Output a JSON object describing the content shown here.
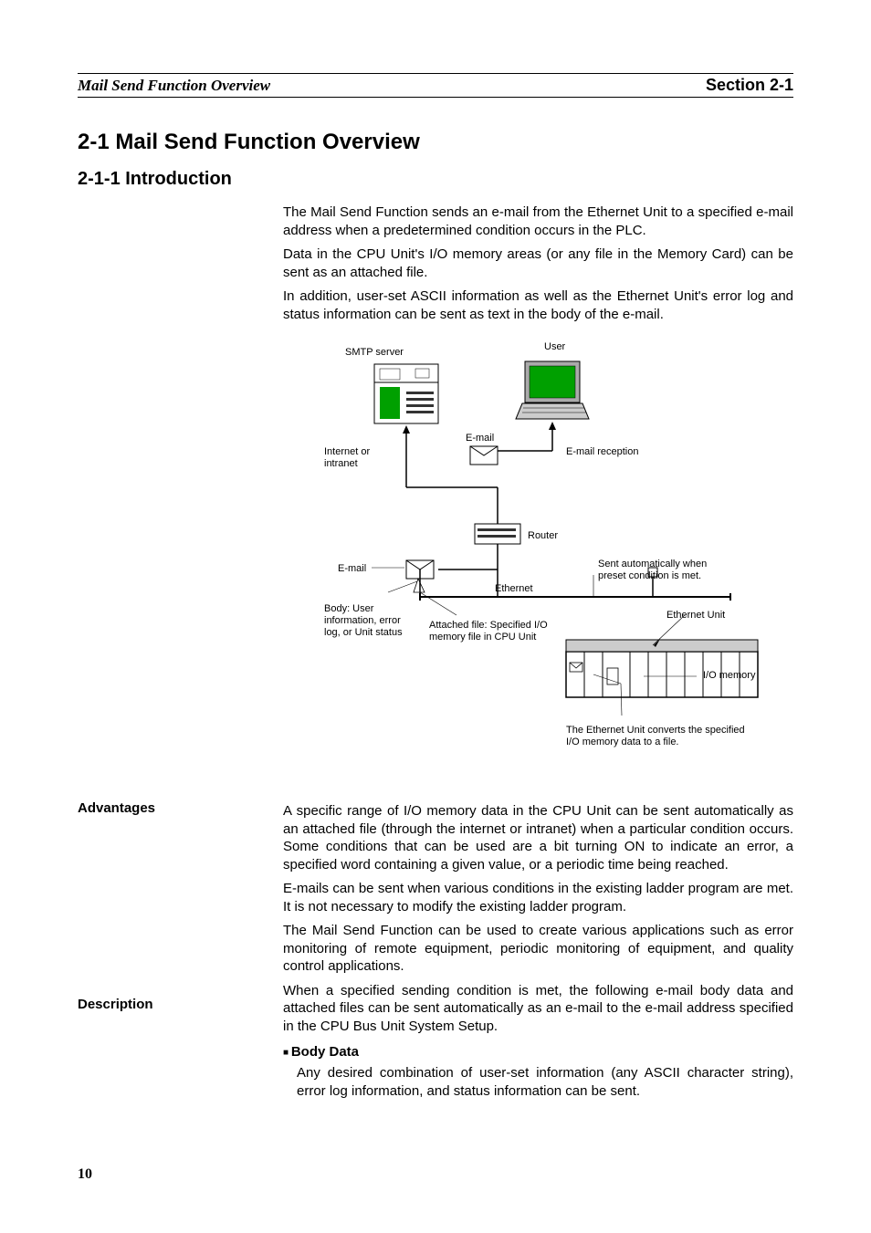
{
  "header": {
    "left": "Mail Send Function Overview",
    "right": "Section 2-1"
  },
  "h1": "2-1    Mail Send Function Overview",
  "h2": "2-1-1    Introduction",
  "intro": {
    "p1": "The Mail Send Function sends an e-mail from the Ethernet Unit to a specified e-mail address when a predetermined condition occurs in the PLC.",
    "p2": "Data in the CPU Unit's I/O memory areas (or any file in the Memory Card) can be sent as an attached file.",
    "p3": "In addition, user-set ASCII information as well as the Ethernet Unit's error log and status information can be sent as text in the body of the e-mail."
  },
  "diagram": {
    "smtp_server": "SMTP server",
    "user": "User",
    "internet": "Internet or intranet",
    "email": "E-mail",
    "email_reception": "E-mail reception",
    "router": "Router",
    "email2": "E-mail",
    "ethernet": "Ethernet",
    "sent_auto": "Sent automatically when preset condition is met.",
    "body_user": "Body: User information, error log, or Unit status",
    "attached_file": "Attached file: Specified I/O memory file in CPU Unit",
    "ethernet_unit": "Ethernet Unit",
    "io_memory": "I/O memory",
    "converts": "The Ethernet Unit converts the specified I/O memory data to a file."
  },
  "advantages": {
    "label": "Advantages",
    "p1": "A specific range of I/O memory data in the CPU Unit can be sent automatically as an attached file (through the internet or intranet) when a particular condition occurs. Some conditions that can be used are a bit turning ON to indicate an error, a specified word containing a given value, or a periodic time being reached.",
    "p2": "E-mails can be sent when various conditions in the existing ladder program are met. It is not necessary to modify the existing ladder program.",
    "p3": "The Mail Send Function can be used to create various applications such as error monitoring of remote equipment, periodic monitoring of equipment, and quality control applications."
  },
  "description": {
    "label": "Description",
    "p1": "When a specified sending condition is met, the following e-mail body data and attached files can be sent automatically as an e-mail to the e-mail address specified in the CPU Bus Unit System Setup."
  },
  "body_data": {
    "label": "Body Data",
    "p1": "Any desired combination of user-set information (any ASCII character string), error log information, and status information can be sent."
  },
  "page_number": "10"
}
